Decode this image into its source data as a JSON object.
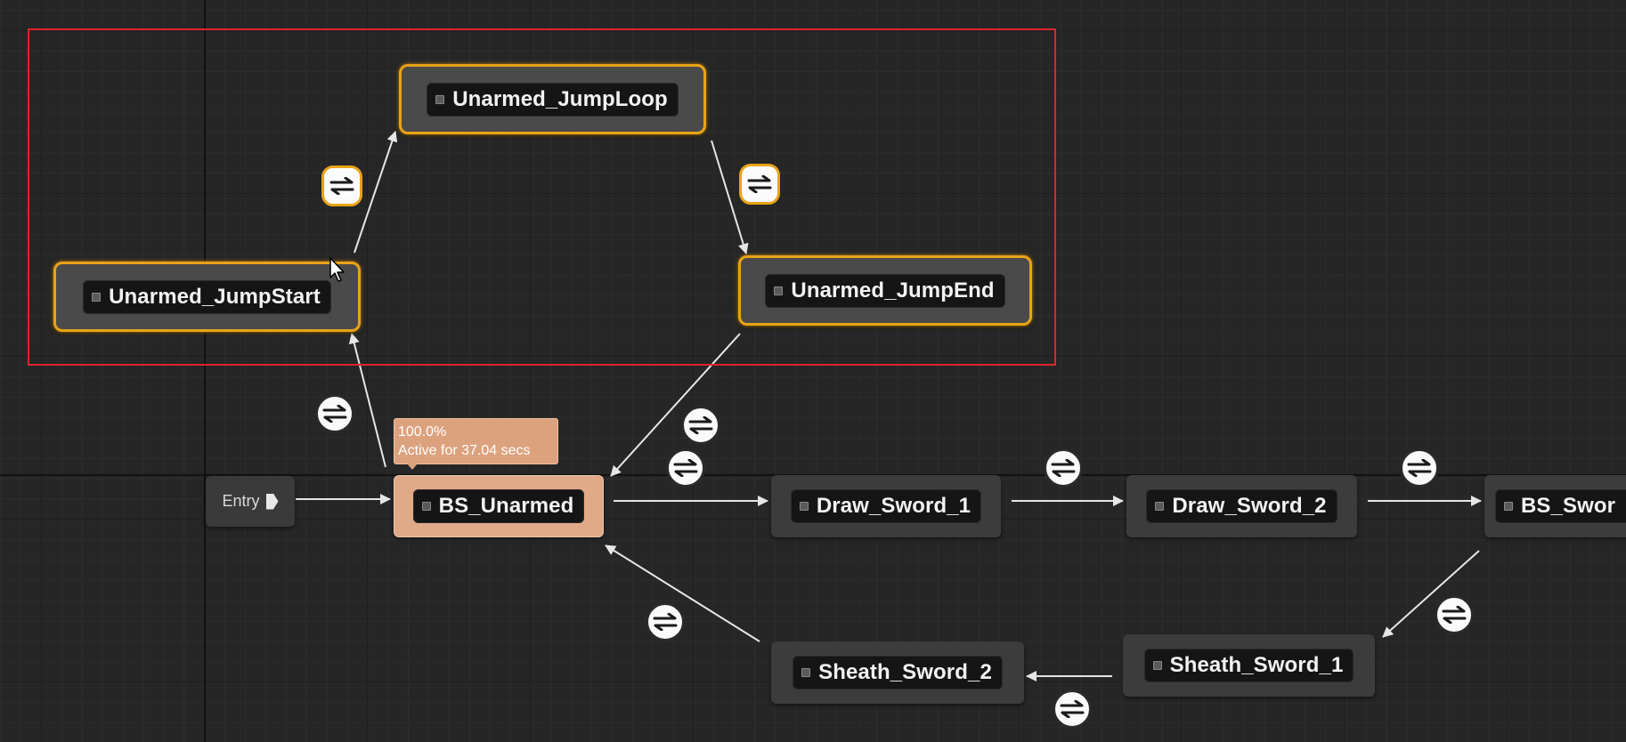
{
  "entry": {
    "label": "Entry"
  },
  "states": {
    "unarmed_jump_loop": "Unarmed_JumpLoop",
    "unarmed_jump_start": "Unarmed_JumpStart",
    "unarmed_jump_end": "Unarmed_JumpEnd",
    "bs_unarmed": "BS_Unarmed",
    "draw_sword_1": "Draw_Sword_1",
    "draw_sword_2": "Draw_Sword_2",
    "bs_sword": "BS_Swor",
    "sheath_sword_1": "Sheath_Sword_1",
    "sheath_sword_2": "Sheath_Sword_2"
  },
  "active_state_tooltip": {
    "weight": "100.0%",
    "duration": "Active for 37.04 secs"
  },
  "icons": {
    "state_glyph": "state-node-icon",
    "transition": "transition-rule-icon",
    "entry_arrow": "exec-arrow-icon",
    "cursor": "mouse-cursor-icon"
  },
  "colors": {
    "graph_background": "#262626",
    "selection_outline": "#e0242a",
    "selected_state_border": "#e8a317",
    "active_state_fill": "#e0aa88",
    "state_fill": "#3c3c3c",
    "wire": "#e6e6e6"
  }
}
